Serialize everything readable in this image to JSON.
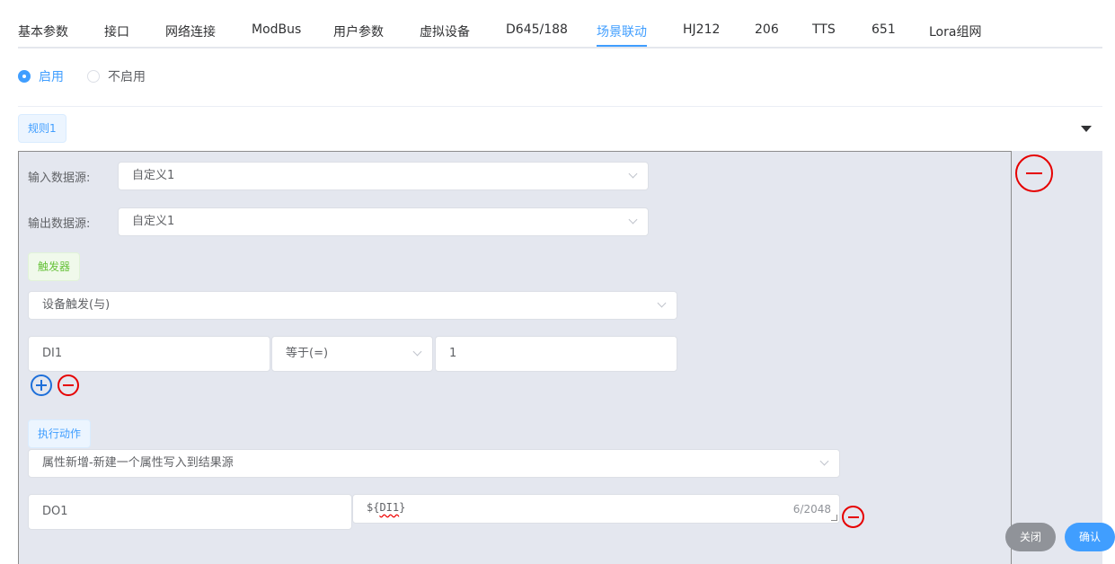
{
  "tabs": [
    {
      "label": "基本参数"
    },
    {
      "label": "接口"
    },
    {
      "label": "网络连接"
    },
    {
      "label": "ModBus"
    },
    {
      "label": "用户参数"
    },
    {
      "label": "虚拟设备"
    },
    {
      "label": "D645/188"
    },
    {
      "label": "场景联动",
      "active": true
    },
    {
      "label": "HJ212"
    },
    {
      "label": "206"
    },
    {
      "label": "TTS"
    },
    {
      "label": "651"
    },
    {
      "label": "Lora组网"
    }
  ],
  "enable": {
    "on_label": "启用",
    "off_label": "不启用",
    "selected": "启用"
  },
  "rule": {
    "tag": "规则1",
    "input_source_label": "输入数据源:",
    "input_source_value": "自定义1",
    "output_source_label": "输出数据源:",
    "output_source_value": "自定义1",
    "trigger_tag": "触发器",
    "trigger_type": "设备触发(与)",
    "condition": {
      "field": "DI1",
      "operator": "等于(=)",
      "value": "1"
    },
    "action_tag": "执行动作",
    "action_type": "属性新增-新建一个属性写入到结果源",
    "action_row": {
      "target": "DO1",
      "expr_prefix": "${",
      "expr_var": "DI1",
      "expr_suffix": "}",
      "char_count": "6/2048"
    }
  },
  "footer": {
    "close_label": "关闭",
    "confirm_label": "确认"
  },
  "colors": {
    "accent": "#409eff",
    "danger": "#e60000",
    "panel_bg": "#e4e7ef"
  }
}
